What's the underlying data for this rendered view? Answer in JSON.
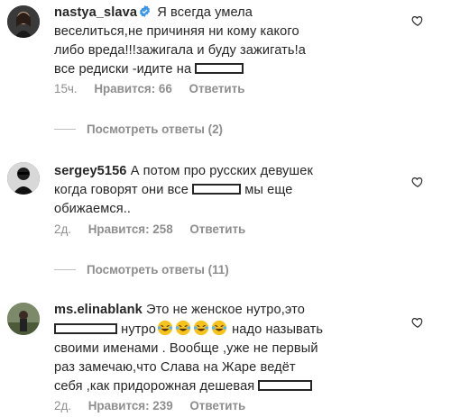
{
  "comments": [
    {
      "username": "nastya_slava",
      "verified": true,
      "parts": [
        "Я всегда умела",
        "веселиться,не причиняя ни кому какого",
        "либо вреда!!!зажигала и  буду зажигать!а",
        "все редиски -идите на"
      ],
      "time": "15ч.",
      "likes": "Нравится: 66",
      "reply": "Ответить",
      "view_replies": "Посмотреть ответы (2)"
    },
    {
      "username": "sergey5156",
      "parts": [
        "А потом про русских девушек",
        "когда говорят они все",
        "мы еще",
        "обижаемся.."
      ],
      "time": "2д.",
      "likes": "Нравится: 258",
      "reply": "Ответить",
      "view_replies": "Посмотреть ответы (11)"
    },
    {
      "username": "ms.elinablank",
      "parts": [
        "Это не женское нутро,это",
        "нутро",
        "надо называть",
        "своими именами . Вообще ,уже не первый",
        "раз замечаю,что Слава на Жаре ведёт",
        "себя ,как придорожная дешевая"
      ],
      "time": "2д.",
      "likes": "Нравится: 239",
      "reply": "Ответить"
    }
  ],
  "icons": {
    "like": "heart-outline-icon",
    "verified": "verified-badge-icon",
    "emoji": "laughing-tears-emoji"
  },
  "colors": {
    "text": "#262626",
    "muted": "#8e8e8e",
    "verified": "#3897f0"
  }
}
